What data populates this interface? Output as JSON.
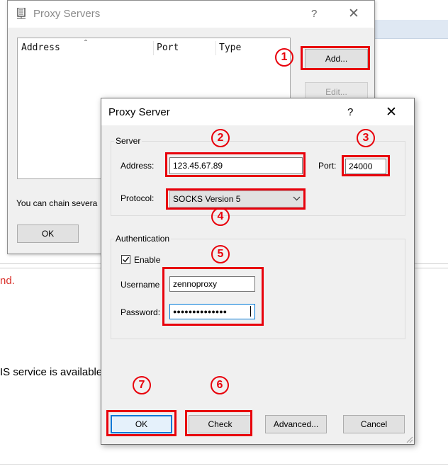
{
  "dialog_servers": {
    "title": "Proxy Servers",
    "help": "?",
    "close": "✕",
    "columns": [
      "Address",
      "Port",
      "Type"
    ],
    "sort_caret": "ˆ",
    "add_label": "Add...",
    "edit_label": "Edit...",
    "chain_text": "You can chain severa",
    "ok_label": "OK"
  },
  "dialog_server": {
    "title": "Proxy Server",
    "help": "?",
    "close": "✕",
    "server_group": "Server",
    "address_label": "Address:",
    "address_value": "123.45.67.89",
    "port_label": "Port:",
    "port_value": "24000",
    "protocol_label": "Protocol:",
    "protocol_value": "SOCKS Version 5",
    "auth_group": "Authentication",
    "enable_label": "Enable",
    "enable_checked": true,
    "username_label": "Username",
    "username_value": "zennoproxy",
    "password_label": "Password:",
    "password_mask": "●●●●●●●●●●●●●●",
    "ok_label": "OK",
    "check_label": "Check",
    "advanced_label": "Advanced...",
    "cancel_label": "Cancel"
  },
  "background": {
    "red_text": "nd.",
    "ns_text": "IS service is available"
  },
  "annotations": {
    "n1": "1",
    "n2": "2",
    "n3": "3",
    "n4": "4",
    "n5": "5",
    "n6": "6",
    "n7": "7"
  },
  "colors": {
    "annotation_red": "#e8000b",
    "focus_blue": "#0078d7",
    "dialog_bg": "#f0f0f0"
  }
}
